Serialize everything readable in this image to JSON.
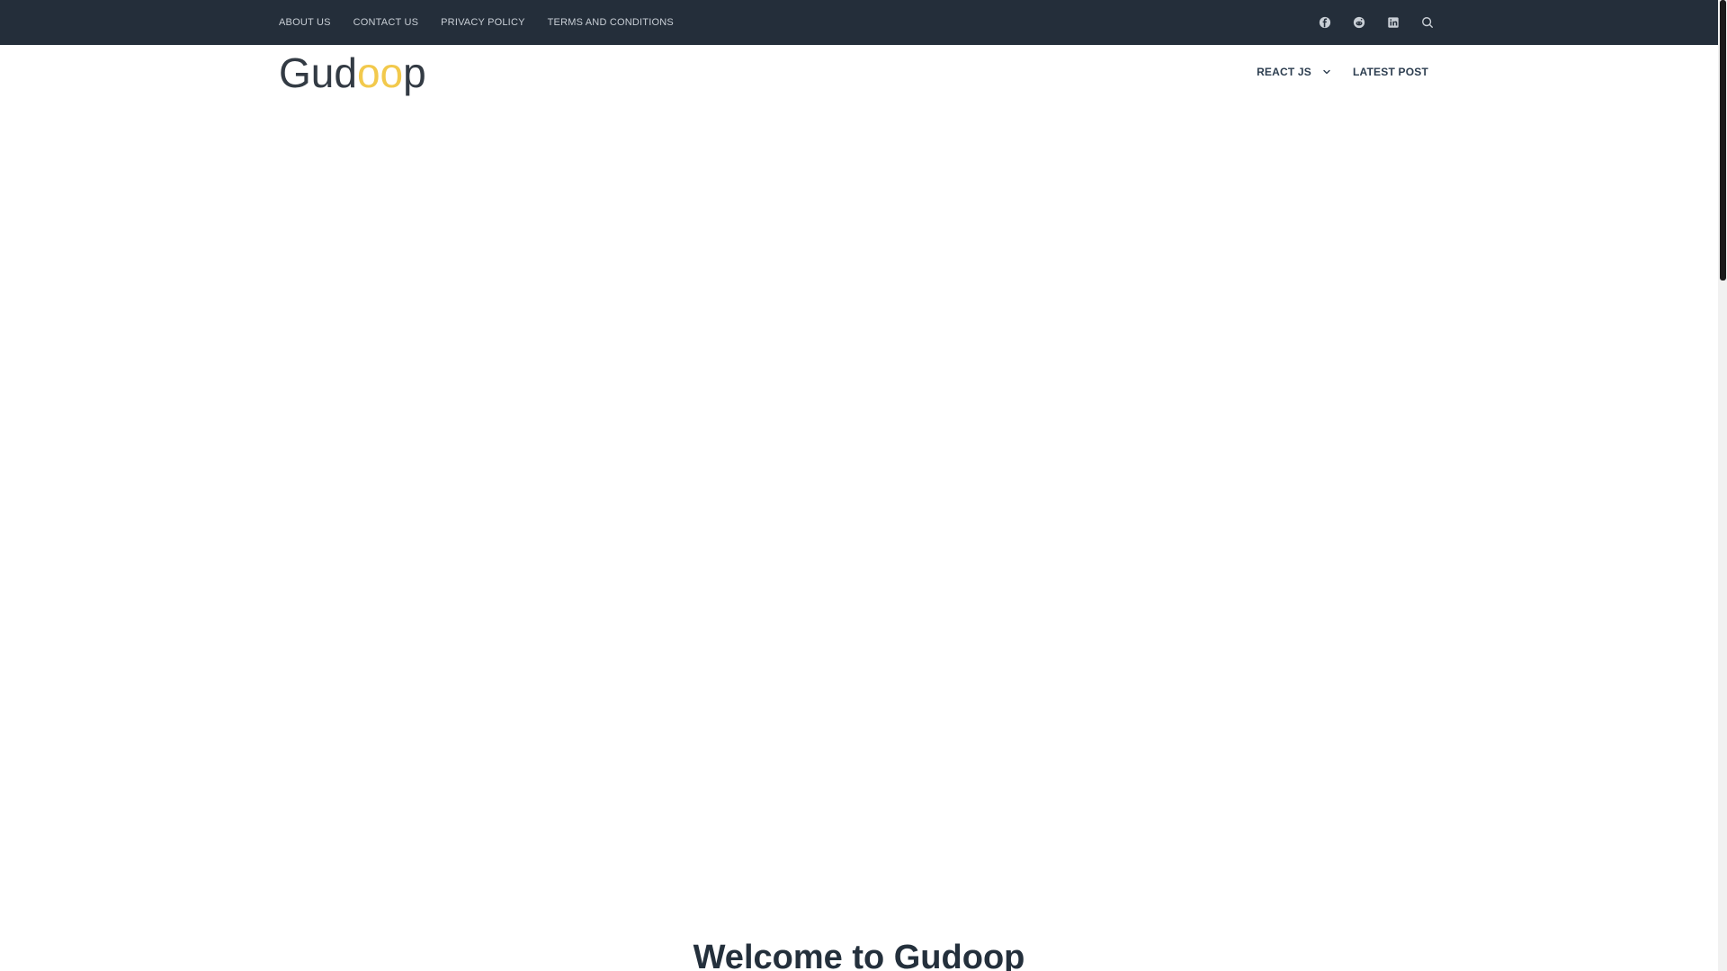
{
  "topbar": {
    "links": [
      "ABOUT US",
      "CONTACT US",
      "PRIVACY POLICY",
      "TERMS AND CONDITIONS"
    ],
    "social_icons": [
      "facebook-icon",
      "reddit-icon",
      "linkedin-icon",
      "search-icon"
    ]
  },
  "header": {
    "logo": {
      "part1": "Gud",
      "part2": "oo",
      "part3": "p"
    },
    "nav": {
      "react_js": "REACT JS",
      "latest_post": "LATEST POST"
    }
  },
  "hero": {
    "title": "Welcome to Gudoop"
  },
  "colors": {
    "topbar_bg": "#242e3a",
    "logo_accent": "#f2c94c",
    "heading": "#24303c"
  }
}
